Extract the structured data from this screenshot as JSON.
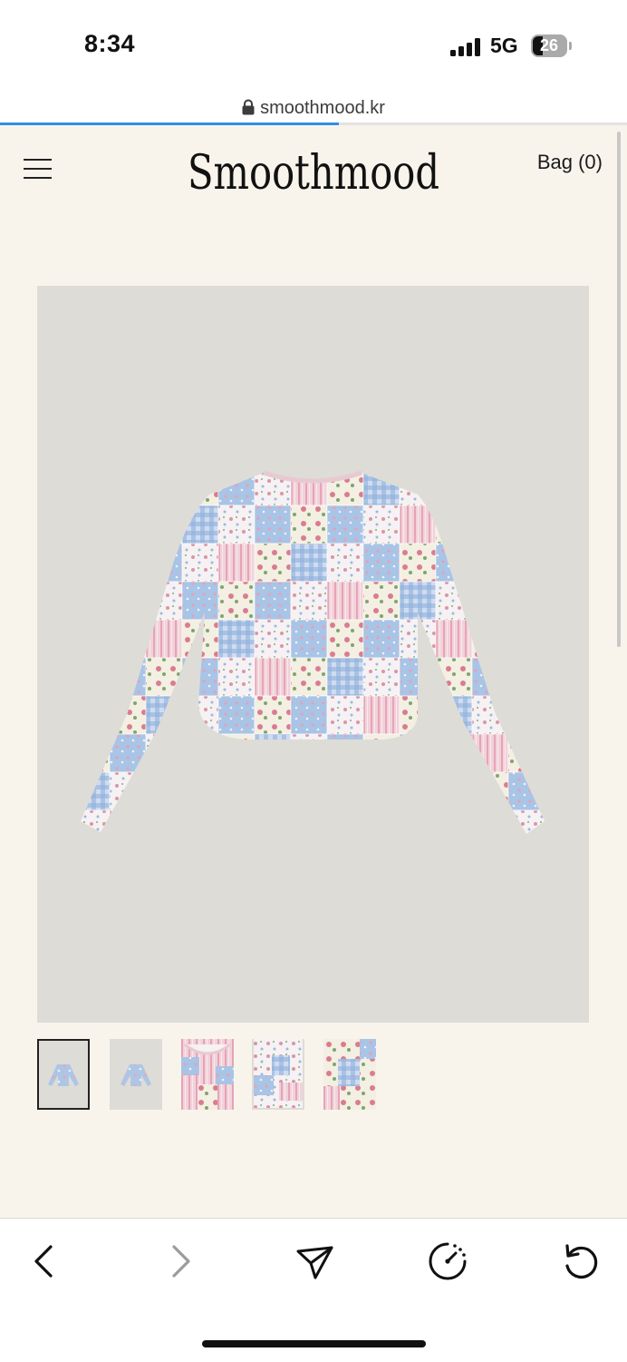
{
  "status_bar": {
    "time": "8:34",
    "network": "5G",
    "battery_level": "26"
  },
  "browser": {
    "url": "smoothmood.kr",
    "load_progress": 0.54,
    "toolbar_icons": [
      "back-icon",
      "forward-icon",
      "share-icon",
      "speed-dial-icon",
      "reload-icon"
    ]
  },
  "site": {
    "brand": "Smoothmood",
    "bag_label": "Bag (0)"
  },
  "product": {
    "image_description_icon": "patchwork-floral-long-sleeve-top",
    "thumbnails": [
      {
        "name": "thumbnail-front",
        "selected": true
      },
      {
        "name": "thumbnail-back",
        "selected": false
      },
      {
        "name": "thumbnail-neckline-detail",
        "selected": false
      },
      {
        "name": "thumbnail-folded-detail",
        "selected": false
      },
      {
        "name": "thumbnail-fabric-detail",
        "selected": false
      }
    ]
  },
  "colors": {
    "page_bg": "#f8f4ec",
    "image_bg": "#dddcd7",
    "progress": "#2f8fe6",
    "patch_blue": "#a8c4e6",
    "patch_pink": "#efc3cf",
    "patch_white": "#f6f1f1"
  }
}
